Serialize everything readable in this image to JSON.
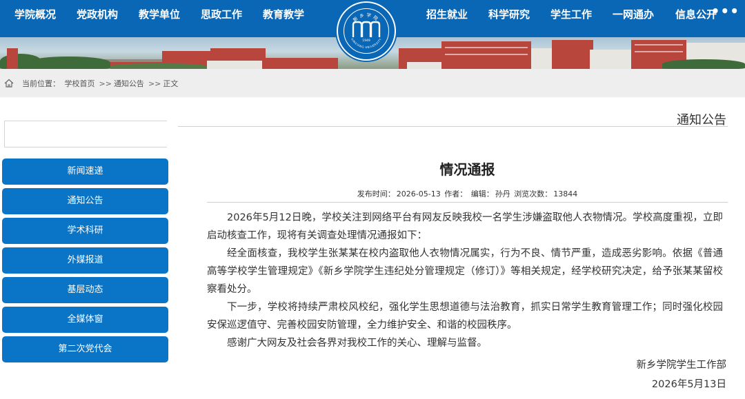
{
  "nav": {
    "left": [
      "学院概况",
      "党政机构",
      "教学单位",
      "思政工作",
      "教育教学"
    ],
    "right": [
      "招生就业",
      "科学研究",
      "学生工作",
      "一网通办",
      "信息公开"
    ],
    "more": "•••"
  },
  "logo": {
    "name_cn": "新乡学院",
    "name_en": "XINXIANG UNIVERSITY",
    "year": "1949"
  },
  "breadcrumb": {
    "prefix": "当前位置：",
    "items": [
      "学校首页",
      "通知公告",
      "正文"
    ],
    "separator": ">>"
  },
  "sidebar": {
    "items": [
      "新闻速递",
      "通知公告",
      "学术科研",
      "外媒报道",
      "基层动态",
      "全媒体窗",
      "第二次党代会"
    ]
  },
  "section": {
    "title": "通知公告"
  },
  "article": {
    "title": "情况通报",
    "meta": {
      "publish_label": "发布时间：",
      "publish_date": "2026-05-13",
      "author_label": "作者：",
      "editor_label": "编辑：",
      "editor": "孙丹",
      "views_label": "浏览次数：",
      "views": "13844"
    },
    "paragraphs": [
      "2026年5月12日晚，学校关注到网络平台有网友反映我校一名学生涉嫌盗取他人衣物情况。学校高度重视，立即启动核查工作，现将有关调查处理情况通报如下：",
      "经全面核查，我校学生张某某在校内盗取他人衣物情况属实，行为不良、情节严重，造成恶劣影响。依据《普通高等学校学生管理规定》《新乡学院学生违纪处分管理规定（修订）》等相关规定，经学校研究决定，给予张某某留校察看处分。",
      "下一步，学校将持续严肃校风校纪，强化学生思想道德与法治教育，抓实日常学生教育管理工作；同时强化校园安保巡逻值守、完善校园安防管理，全力维护安全、和谐的校园秩序。",
      "感谢广大网友及社会各界对我校工作的关心、理解与监督。"
    ],
    "signature": "新乡学院学生工作部",
    "date": "2026年5月13日"
  },
  "colors": {
    "primary": "#0a67b5",
    "menu": "#0a74c6",
    "crumb_bg": "#eeeeee"
  }
}
